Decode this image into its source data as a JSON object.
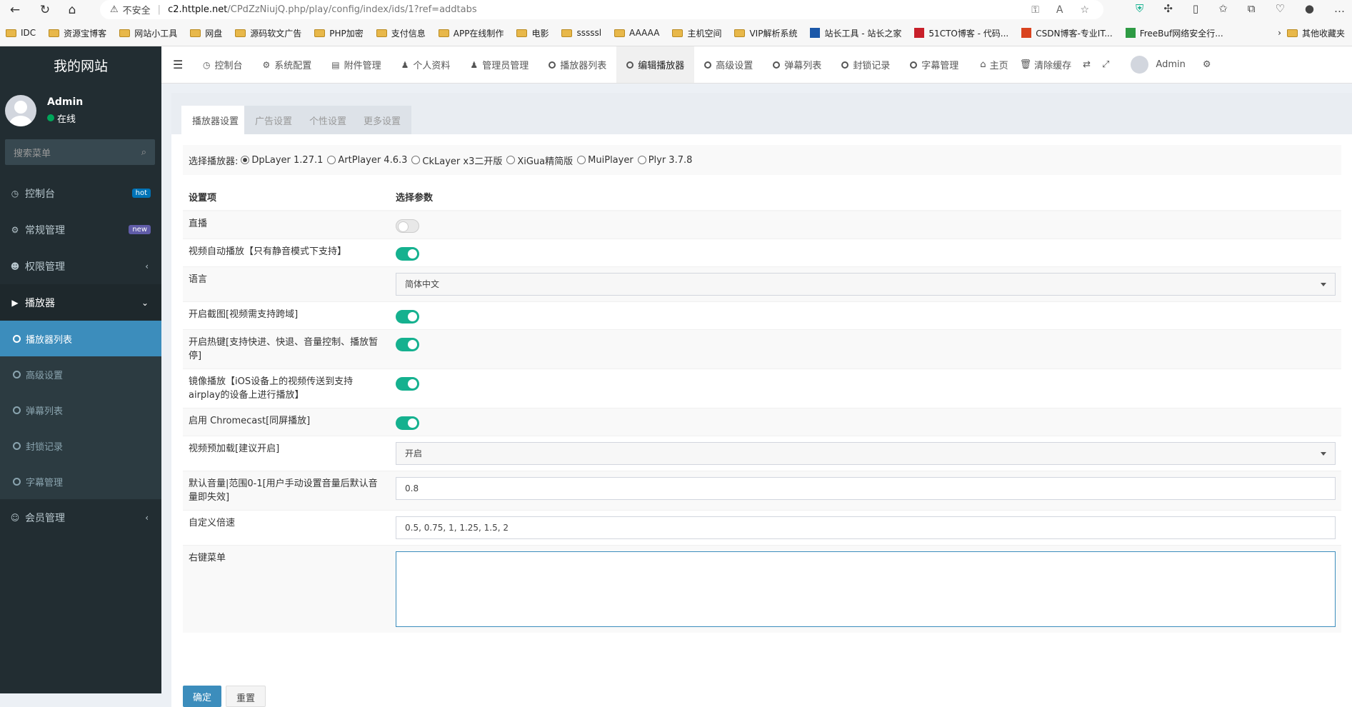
{
  "browser": {
    "warning": "不安全",
    "host": "c2.httple.net",
    "path": "/CPdZzNiujQ.php/play/config/index/ids/1?ref=addtabs"
  },
  "bookmarks": [
    {
      "label": "IDC",
      "kind": "folder"
    },
    {
      "label": "资源宝博客",
      "kind": "folder"
    },
    {
      "label": "网站小工具",
      "kind": "folder"
    },
    {
      "label": "网盘",
      "kind": "folder"
    },
    {
      "label": "源码软文广告",
      "kind": "folder"
    },
    {
      "label": "PHP加密",
      "kind": "folder"
    },
    {
      "label": "支付信息",
      "kind": "folder"
    },
    {
      "label": "APP在线制作",
      "kind": "folder"
    },
    {
      "label": "电影",
      "kind": "folder"
    },
    {
      "label": "sssssl",
      "kind": "folder"
    },
    {
      "label": "AAAAA",
      "kind": "folder"
    },
    {
      "label": "主机空间",
      "kind": "folder"
    },
    {
      "label": "VIP解析系统",
      "kind": "folder"
    },
    {
      "label": "站长工具 - 站长之家",
      "kind": "site"
    },
    {
      "label": "51CTO博客 - 代码...",
      "kind": "site"
    },
    {
      "label": "CSDN博客-专业IT...",
      "kind": "site"
    },
    {
      "label": "FreeBuf网络安全行...",
      "kind": "site"
    }
  ],
  "bookmarks_more": "其他收藏夹",
  "sidebar": {
    "site_title": "我的网站",
    "user_name": "Admin",
    "user_status": "在线",
    "search_placeholder": "搜索菜单",
    "items": [
      {
        "label": "控制台",
        "badge": "hot",
        "badge_color": "#0073b7"
      },
      {
        "label": "常规管理",
        "badge": "new",
        "badge_color": "#605ca8"
      },
      {
        "label": "权限管理",
        "chevron": "‹"
      },
      {
        "label": "播放器",
        "chevron": "⌄"
      }
    ],
    "sub_items": [
      {
        "label": "播放器列表"
      },
      {
        "label": "高级设置"
      },
      {
        "label": "弹幕列表"
      },
      {
        "label": "封锁记录"
      },
      {
        "label": "字幕管理"
      }
    ],
    "member": "会员管理"
  },
  "topnav": {
    "tabs": [
      {
        "label": "控制台",
        "icon": "dashboard-icon"
      },
      {
        "label": "系统配置",
        "icon": "gear-icon"
      },
      {
        "label": "附件管理",
        "icon": "file-icon"
      },
      {
        "label": "个人资料",
        "icon": "user-icon"
      },
      {
        "label": "管理员管理",
        "icon": "user-icon"
      },
      {
        "label": "播放器列表",
        "icon": "circle-icon"
      },
      {
        "label": "编辑播放器",
        "icon": "circle-icon"
      },
      {
        "label": "高级设置",
        "icon": "circle-icon"
      },
      {
        "label": "弹幕列表",
        "icon": "circle-icon"
      },
      {
        "label": "封锁记录",
        "icon": "circle-icon"
      },
      {
        "label": "字幕管理",
        "icon": "circle-icon"
      }
    ],
    "home": "主页",
    "clear_cache": "清除缓存",
    "admin": "Admin"
  },
  "panel": {
    "tabs": [
      "播放器设置",
      "广告设置",
      "个性设置",
      "更多设置"
    ],
    "choose_label": "选择播放器:",
    "players": [
      "DpLayer 1.27.1",
      "ArtPlayer 4.6.3",
      "CkLayer x3二开版",
      "XiGua精简版",
      "MuiPlayer",
      "Plyr 3.7.8"
    ],
    "col_setting": "设置项",
    "col_param": "选择参数",
    "rows": [
      {
        "label": "直播",
        "type": "switch",
        "on": false
      },
      {
        "label": "视频自动播放【只有静音模式下支持】",
        "type": "switch",
        "on": true
      },
      {
        "label": "语言",
        "type": "select",
        "value": "简体中文"
      },
      {
        "label": "开启截图[视频需支持跨域]",
        "type": "switch",
        "on": true
      },
      {
        "label": "开启热键[支持快进、快退、音量控制、播放暂停]",
        "type": "switch",
        "on": true
      },
      {
        "label": "镜像播放【iOS设备上的视频传送到支持airplay的设备上进行播放】",
        "type": "switch",
        "on": true
      },
      {
        "label": "启用 Chromecast[同屏播放]",
        "type": "switch",
        "on": true
      },
      {
        "label": "视频预加载[建议开启]",
        "type": "select",
        "value": "开启"
      },
      {
        "label": "默认音量|范围0-1[用户手动设置音量后默认音量即失效]",
        "type": "input",
        "value": "0.8"
      },
      {
        "label": "自定义倍速",
        "type": "input",
        "value": "0.5, 0.75, 1, 1.25, 1.5, 2"
      },
      {
        "label": "右键菜单",
        "type": "textarea",
        "value": ""
      }
    ],
    "btn_submit": "确定",
    "btn_reset": "重置"
  }
}
